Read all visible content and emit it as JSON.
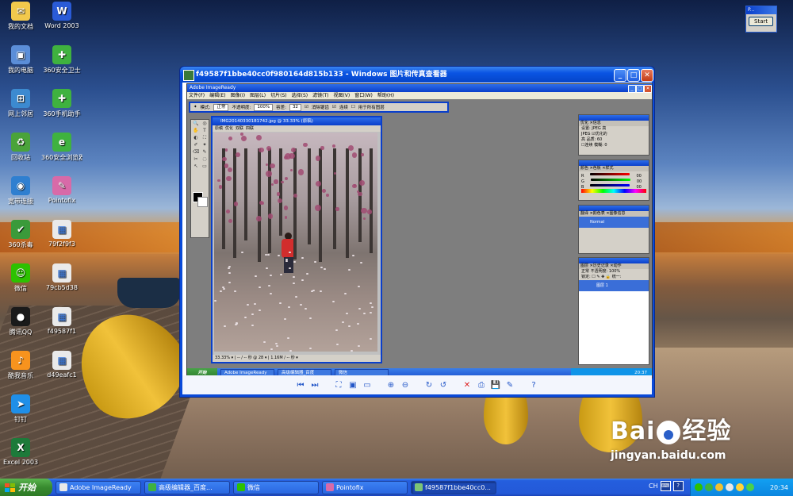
{
  "desktop": {
    "icons": [
      {
        "label": "我的文档",
        "icon": "my-documents-icon",
        "color": "#f2c94c",
        "glyph": "✉"
      },
      {
        "label": "我的电脑",
        "icon": "my-computer-icon",
        "color": "#5b8ed8",
        "glyph": "▣"
      },
      {
        "label": "网上邻居",
        "icon": "network-places-icon",
        "color": "#3c8ad0",
        "glyph": "⊞"
      },
      {
        "label": "回收站",
        "icon": "recycle-bin-icon",
        "color": "#4aa33a",
        "glyph": "♻"
      },
      {
        "label": "宽带连接",
        "icon": "broadband-connection-icon",
        "color": "#2f7fd0",
        "glyph": "◉"
      },
      {
        "label": "360杀毒",
        "icon": "360-antivirus-icon",
        "color": "#3a9a3a",
        "glyph": "✔"
      },
      {
        "label": "微信",
        "icon": "wechat-icon",
        "color": "#2dc100",
        "glyph": "☺"
      },
      {
        "label": "腾讯QQ",
        "icon": "qq-icon",
        "color": "#1a1a1a",
        "glyph": "●"
      },
      {
        "label": "酷我音乐",
        "icon": "kuwo-music-icon",
        "color": "#f7931e",
        "glyph": "♪"
      },
      {
        "label": "钉钉",
        "icon": "dingtalk-icon",
        "color": "#1f8fe8",
        "glyph": "➤"
      },
      {
        "label": "Excel 2003",
        "icon": "excel-icon",
        "color": "#1d7a3a",
        "glyph": "X"
      },
      {
        "label": "Word 2003",
        "icon": "word-icon",
        "color": "#2a5bd7",
        "glyph": "W"
      },
      {
        "label": "360安全卫士",
        "icon": "360-security-icon",
        "color": "#3fb23f",
        "glyph": "✚"
      },
      {
        "label": "360手机助手",
        "icon": "360-phone-assistant-icon",
        "color": "#3fb23f",
        "glyph": "✚"
      },
      {
        "label": "360安全浏览器",
        "icon": "360-browser-icon",
        "color": "#3fb23f",
        "glyph": "e"
      },
      {
        "label": "Pointofix",
        "icon": "pointofix-icon",
        "color": "#d86aa8",
        "glyph": "✎"
      },
      {
        "label": "79f2f9f3",
        "icon": "image-file-icon",
        "color": "#eaeaea",
        "glyph": "▦"
      },
      {
        "label": "79cb5d38",
        "icon": "image-file-icon",
        "color": "#eaeaea",
        "glyph": "▦"
      },
      {
        "label": "f49587f1",
        "icon": "image-file-icon",
        "color": "#eaeaea",
        "glyph": "▦"
      },
      {
        "label": "d49eafc1",
        "icon": "image-file-icon",
        "color": "#eaeaea",
        "glyph": "▦"
      }
    ],
    "start_widget": {
      "title": "P...",
      "button": "Start"
    }
  },
  "viewer": {
    "title": "f49587f1bbe40cc0f980164d815b133 - Windows 图片和传真查看器",
    "toolbar": [
      "previous-icon",
      "next-icon",
      "best-fit-icon",
      "actual-size-icon",
      "slideshow-icon",
      "zoom-in-icon",
      "zoom-out-icon",
      "rotate-cw-icon",
      "rotate-ccw-icon",
      "delete-icon",
      "print-icon",
      "save-icon",
      "edit-icon",
      "help-icon"
    ]
  },
  "imageready": {
    "title": "Adobe ImageReady",
    "menu": [
      "文件(F)",
      "编辑(E)",
      "图像(I)",
      "图层(L)",
      "切片(S)",
      "选择(S)",
      "滤镜(T)",
      "视图(V)",
      "窗口(W)",
      "帮助(H)"
    ],
    "options": {
      "mode_label": "模式:",
      "mode_value": "正常",
      "opacity_label": "不透明度:",
      "opacity_value": "100%",
      "tolerance_label": "容差:",
      "tolerance_value": "32",
      "antialias": "消除锯齿",
      "contiguous": "连续",
      "all_layers": "用于所有图层"
    },
    "document": {
      "title": "IMG20140330181742.jpg @ 33.33% (原稿)",
      "tabs": [
        "原稿",
        "优化",
        "双联",
        "四联"
      ],
      "status": "33.33% ▾ | -- / -- 秒 @ 28 ▾ | 1.16M / -- 秒 ▾"
    },
    "panels": {
      "optimize": {
        "tabs": "优化 ✕信息",
        "preset_label": "设置:",
        "preset_value": "JPEG 高",
        "format": "JPEG",
        "optimized": "优化的",
        "quality_label": "品质:",
        "quality_value": "60",
        "level": "高",
        "progressive": "连续",
        "blur_label": "模糊:",
        "blur_value": "0"
      },
      "color": {
        "tabs": "颜色 ✕色板 ✕样式",
        "r": "R",
        "g": "G",
        "b": "B",
        "r_val": "00",
        "g_val": "00",
        "b_val": "00"
      },
      "history": {
        "tabs": "翻译 ✕颜色表 ✕图像信息",
        "item": "Normal"
      },
      "layers": {
        "tabs": "图层 ✕历史记录 ✕动作",
        "blend": "正常",
        "opacity_label": "不透明度:",
        "opacity_value": "100%",
        "lock_label": "锁定:",
        "unify_label": "统一:",
        "layer_name": "图层 1"
      }
    },
    "taskbar": {
      "start": "开始",
      "tasks": [
        "Adobe ImageReady",
        "高级编辑器_百度",
        "微信"
      ],
      "time": "20:37"
    }
  },
  "taskbar": {
    "start": "开始",
    "tasks": [
      {
        "label": "Adobe ImageReady",
        "icon": "imageready-icon",
        "color": "#e8e8e8"
      },
      {
        "label": "高级编辑器_百度...",
        "icon": "browser-icon",
        "color": "#3fb23f"
      },
      {
        "label": "微信",
        "icon": "wechat-icon",
        "color": "#2dc100"
      },
      {
        "label": "Pointofix",
        "icon": "pointofix-icon",
        "color": "#d86aa8"
      },
      {
        "label": "f49587f1bbe40cc0...",
        "icon": "picture-viewer-icon",
        "color": "#7cc576"
      }
    ],
    "lang": "CH",
    "time": "20:34"
  },
  "watermark": {
    "brand": "Bai",
    "brand2": "经验",
    "url": "jingyan.baidu.com"
  }
}
